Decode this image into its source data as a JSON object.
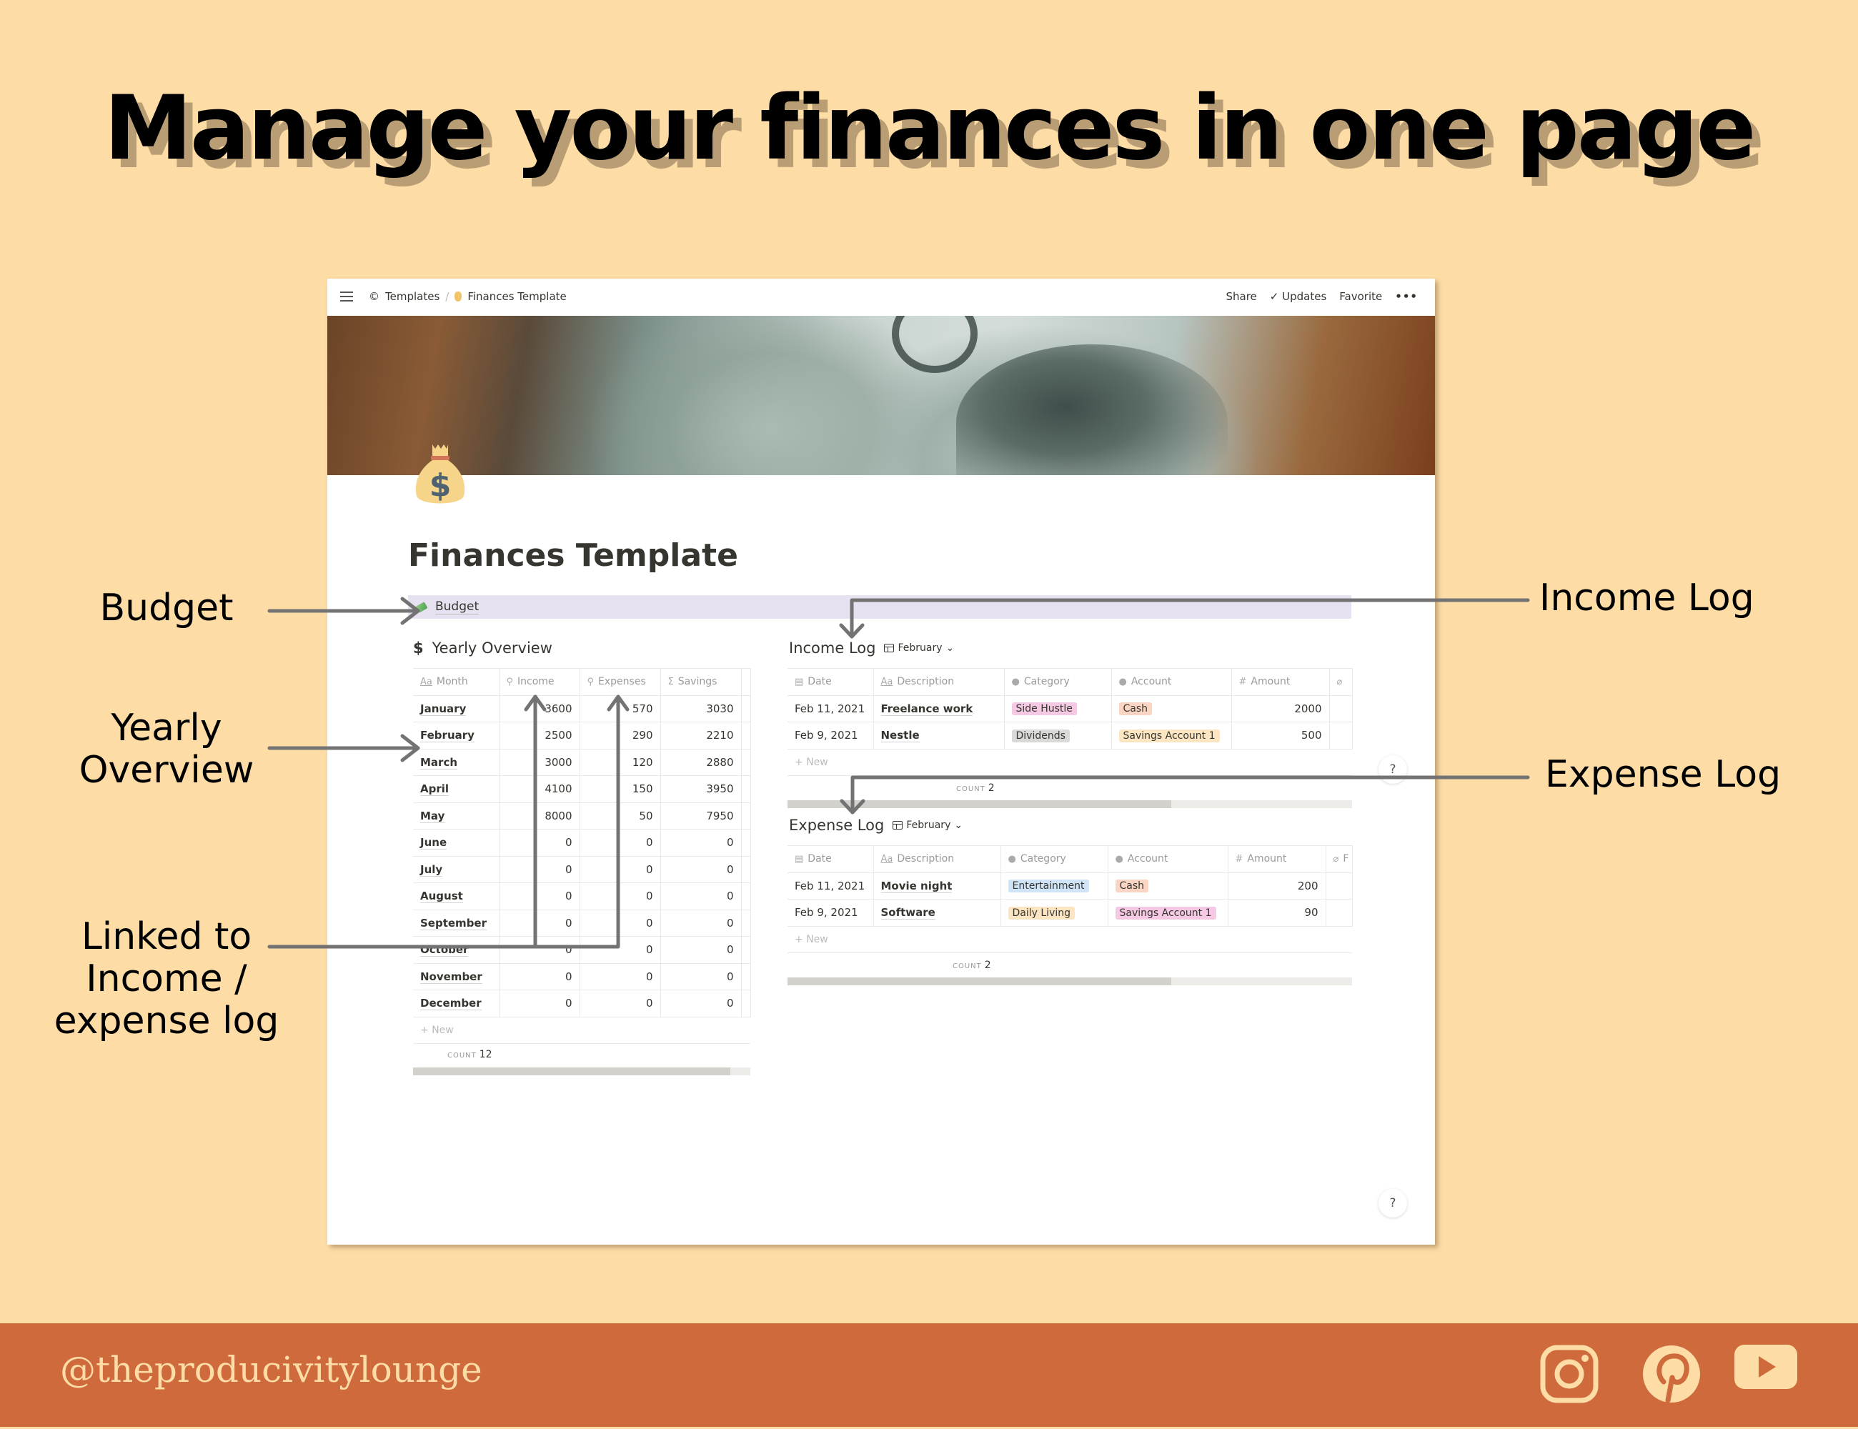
{
  "headline": "Manage your finances in one page",
  "annotations": {
    "budget": "Budget",
    "yearly_overview": [
      "Yearly",
      "Overview"
    ],
    "linked": [
      "Linked to",
      "Income /",
      "expense log"
    ],
    "income_log": "Income Log",
    "expense_log": "Expense Log"
  },
  "window": {
    "breadcrumb": [
      {
        "label": "Templates",
        "icon": "copyright-icon"
      },
      {
        "label": "Finances Template",
        "icon": "money-bag-icon"
      }
    ],
    "breadcrumb_separator": "/",
    "actions": {
      "share": "Share",
      "updates": "Updates",
      "favorite": "Favorite",
      "more": "•••"
    },
    "page_title": "Finances Template",
    "budget_link": "Budget",
    "help": "?"
  },
  "yearly_overview": {
    "title": "Yearly Overview",
    "icon": "$",
    "columns": [
      {
        "label": "Month",
        "icon": "Aa"
      },
      {
        "label": "Income",
        "icon": "search"
      },
      {
        "label": "Expenses",
        "icon": "search"
      },
      {
        "label": "Savings",
        "icon": "Σ"
      }
    ],
    "rows": [
      {
        "month": "January",
        "income": "3600",
        "expenses": "570",
        "savings": "3030"
      },
      {
        "month": "February",
        "income": "2500",
        "expenses": "290",
        "savings": "2210"
      },
      {
        "month": "March",
        "income": "3000",
        "expenses": "120",
        "savings": "2880"
      },
      {
        "month": "April",
        "income": "4100",
        "expenses": "150",
        "savings": "3950"
      },
      {
        "month": "May",
        "income": "8000",
        "expenses": "50",
        "savings": "7950"
      },
      {
        "month": "June",
        "income": "0",
        "expenses": "0",
        "savings": "0"
      },
      {
        "month": "July",
        "income": "0",
        "expenses": "0",
        "savings": "0"
      },
      {
        "month": "August",
        "income": "0",
        "expenses": "0",
        "savings": "0"
      },
      {
        "month": "September",
        "income": "0",
        "expenses": "0",
        "savings": "0"
      },
      {
        "month": "October",
        "income": "0",
        "expenses": "0",
        "savings": "0"
      },
      {
        "month": "November",
        "income": "0",
        "expenses": "0",
        "savings": "0"
      },
      {
        "month": "December",
        "income": "0",
        "expenses": "0",
        "savings": "0"
      }
    ],
    "new_label": "New",
    "count_label": "COUNT",
    "count_value": "12",
    "scroll_fraction": 0.94
  },
  "income_log": {
    "title": "Income Log",
    "view": "February",
    "columns": [
      {
        "label": "Date",
        "icon": "calendar"
      },
      {
        "label": "Description",
        "icon": "Aa"
      },
      {
        "label": "Category",
        "icon": "select"
      },
      {
        "label": "Account",
        "icon": "select"
      },
      {
        "label": "Amount",
        "icon": "#"
      },
      {
        "label": "",
        "icon": "paperclip"
      }
    ],
    "rows": [
      {
        "date": "Feb 11, 2021",
        "description": "Freelance work",
        "category": "Side Hustle",
        "category_color": "#F5C9E3",
        "account": "Cash",
        "account_color": "#FBD5C4",
        "amount": "2000"
      },
      {
        "date": "Feb 9, 2021",
        "description": "Nestle",
        "category": "Dividends",
        "category_color": "#D9D9D7",
        "account": "Savings Account 1",
        "account_color": "#FBE5C2",
        "amount": "500"
      }
    ],
    "new_label": "New",
    "count_label": "COUNT",
    "count_value": "2",
    "scroll_fraction": 0.68
  },
  "expense_log": {
    "title": "Expense Log",
    "view": "February",
    "columns": [
      {
        "label": "Date",
        "icon": "calendar"
      },
      {
        "label": "Description",
        "icon": "Aa"
      },
      {
        "label": "Category",
        "icon": "select"
      },
      {
        "label": "Account",
        "icon": "select"
      },
      {
        "label": "Amount",
        "icon": "#"
      },
      {
        "label": "F",
        "icon": "paperclip"
      }
    ],
    "rows": [
      {
        "date": "Feb 11, 2021",
        "description": "Movie night",
        "category": "Entertainment",
        "category_color": "#CFE5F7",
        "account": "Cash",
        "account_color": "#FBD5C4",
        "amount": "200"
      },
      {
        "date": "Feb 9, 2021",
        "description": "Software",
        "category": "Daily Living",
        "category_color": "#FBE5C2",
        "account": "Savings Account 1",
        "account_color": "#F5C9E3",
        "amount": "90"
      }
    ],
    "new_label": "New",
    "count_label": "COUNT",
    "count_value": "2",
    "scroll_fraction": 0.68
  },
  "footer": {
    "handle": "@theproducivitylounge",
    "social": [
      "instagram-icon",
      "pinterest-icon",
      "youtube-icon"
    ]
  },
  "colors": {
    "background": "#FDDCA6",
    "footer": "#CF6A3C",
    "footer_text": "#FDDCA6",
    "arrow": "#737373",
    "budget_bar": "#E8E1F1"
  }
}
